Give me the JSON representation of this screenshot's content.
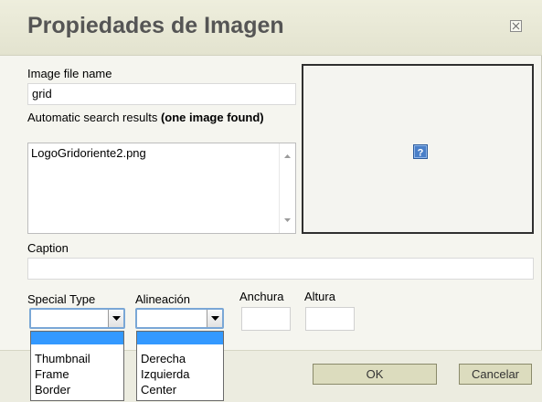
{
  "dialog": {
    "title": "Propiedades de Imagen"
  },
  "form": {
    "file_name_label": "Image file name",
    "file_name_value": "grid",
    "search_results_label": "Automatic search results",
    "search_results_bold": "(one image found)",
    "search_results": [
      "LogoGridoriente2.png"
    ],
    "caption_label": "Caption",
    "caption_value": "",
    "special_type_label": "Special Type",
    "special_type_value": "",
    "special_type_options": [
      "",
      "Thumbnail",
      "Frame",
      "Border"
    ],
    "align_label": "Alineación",
    "align_value": "",
    "align_options": [
      "",
      "Derecha",
      "Izquierda",
      "Center"
    ],
    "width_label": "Anchura",
    "width_value": "",
    "height_label": "Altura",
    "height_value": ""
  },
  "buttons": {
    "ok": "OK",
    "cancel": "Cancelar"
  },
  "icons": {
    "close": "close-icon",
    "preview_placeholder": "question-mark-icon",
    "scroll_up": "scroll-up-arrow-icon",
    "scroll_down": "scroll-down-arrow-icon",
    "dropdown_arrow": "chevron-down-icon"
  },
  "colors": {
    "titlebar": "#e8e8d6",
    "title_text": "#555555",
    "button_bg": "#dcdcbe",
    "selection": "#3399ff",
    "select_border": "#7aa7d6"
  }
}
